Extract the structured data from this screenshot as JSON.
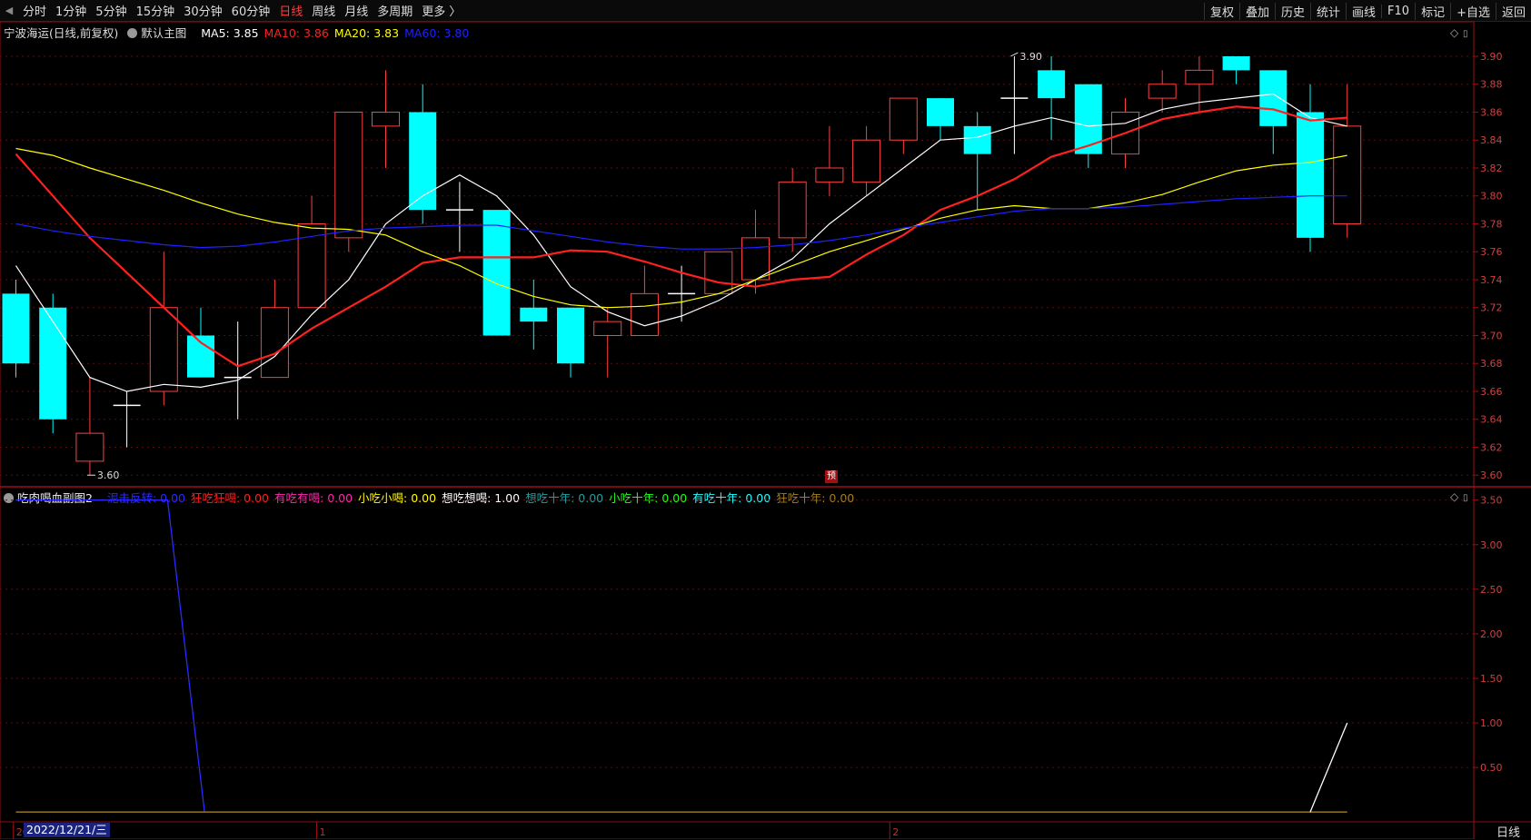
{
  "toolbar": {
    "periods": [
      "分时",
      "1分钟",
      "5分钟",
      "15分钟",
      "30分钟",
      "60分钟",
      "日线",
      "周线",
      "月线",
      "多周期",
      "更多 〉"
    ],
    "active_period": "日线",
    "right_buttons": [
      "复权",
      "叠加",
      "历史",
      "统计",
      "画线",
      "F10",
      "标记",
      "+自选",
      "返回"
    ]
  },
  "main_panel": {
    "stock_name": "宁波海运",
    "mode": "(日线,前复权)",
    "template": "默认主图",
    "ma": [
      {
        "label": "MA5: 3.85",
        "color": "#ffffff"
      },
      {
        "label": "MA10: 3.86",
        "color": "#ff2020"
      },
      {
        "label": "MA20: 3.83",
        "color": "#ffff00"
      },
      {
        "label": "MA60: 3.80",
        "color": "#2020ff"
      }
    ],
    "high_marker": "3.90",
    "low_marker": "3.60",
    "pre_tag": "预"
  },
  "sub_panel": {
    "title": "吃肉喝血副图2",
    "items": [
      {
        "label": "泥击反转: 0.00",
        "color": "#2a2aff"
      },
      {
        "label": "狂吃狂喝: 0.00",
        "color": "#ff2020"
      },
      {
        "label": "有吃有喝: 0.00",
        "color": "#ff2ab0"
      },
      {
        "label": "小吃小喝: 0.00",
        "color": "#ffff00"
      },
      {
        "label": "想吃想喝: 1.00",
        "color": "#ffffff"
      },
      {
        "label": "想吃十年: 0.00",
        "color": "#20a0a0"
      },
      {
        "label": "小吃十年: 0.00",
        "color": "#20ff20"
      },
      {
        "label": "有吃十年: 0.00",
        "color": "#20ffff"
      },
      {
        "label": "狂吃十年: 0.00",
        "color": "#a08020"
      }
    ]
  },
  "bottom": {
    "date_label": "2022/12/21/三",
    "month_marks": [
      "20",
      "1",
      "2"
    ],
    "period_label": "日线"
  },
  "chart_data": {
    "type": "candlestick",
    "y_axis_main": [
      "3.90",
      "3.88",
      "3.86",
      "3.84",
      "3.82",
      "3.80",
      "3.78",
      "3.76",
      "3.74",
      "3.72",
      "3.70",
      "3.68",
      "3.66",
      "3.64",
      "3.62",
      "3.60"
    ],
    "ylim_main": [
      3.593,
      3.913
    ],
    "y_axis_sub": [
      "3.50",
      "3.00",
      "2.50",
      "2.00",
      "1.50",
      "1.00",
      "0.50"
    ],
    "ylim_sub": [
      -0.1,
      3.65
    ],
    "up_color": "#ff4040",
    "down_color": "#00ffff",
    "candles": [
      {
        "o": 3.73,
        "h": 3.74,
        "l": 3.67,
        "c": 3.68
      },
      {
        "o": 3.72,
        "h": 3.73,
        "l": 3.63,
        "c": 3.64
      },
      {
        "o": 3.61,
        "h": 3.67,
        "l": 3.6,
        "c": 3.63
      },
      {
        "o": 3.65,
        "h": 3.66,
        "l": 3.62,
        "c": 3.65
      },
      {
        "o": 3.66,
        "h": 3.76,
        "l": 3.65,
        "c": 3.72
      },
      {
        "o": 3.7,
        "h": 3.72,
        "l": 3.67,
        "c": 3.67
      },
      {
        "o": 3.67,
        "h": 3.71,
        "l": 3.64,
        "c": 3.67
      },
      {
        "o": 3.67,
        "h": 3.74,
        "l": 3.67,
        "c": 3.72
      },
      {
        "o": 3.72,
        "h": 3.8,
        "l": 3.72,
        "c": 3.78
      },
      {
        "o": 3.77,
        "h": 3.86,
        "l": 3.76,
        "c": 3.86
      },
      {
        "o": 3.85,
        "h": 3.89,
        "l": 3.82,
        "c": 3.86
      },
      {
        "o": 3.86,
        "h": 3.88,
        "l": 3.78,
        "c": 3.79
      },
      {
        "o": 3.79,
        "h": 3.81,
        "l": 3.76,
        "c": 3.79
      },
      {
        "o": 3.79,
        "h": 3.79,
        "l": 3.7,
        "c": 3.7
      },
      {
        "o": 3.72,
        "h": 3.74,
        "l": 3.69,
        "c": 3.71
      },
      {
        "o": 3.72,
        "h": 3.72,
        "l": 3.67,
        "c": 3.68
      },
      {
        "o": 3.7,
        "h": 3.72,
        "l": 3.67,
        "c": 3.71
      },
      {
        "o": 3.7,
        "h": 3.75,
        "l": 3.7,
        "c": 3.73
      },
      {
        "o": 3.73,
        "h": 3.75,
        "l": 3.71,
        "c": 3.73
      },
      {
        "o": 3.73,
        "h": 3.76,
        "l": 3.73,
        "c": 3.76
      },
      {
        "o": 3.74,
        "h": 3.79,
        "l": 3.73,
        "c": 3.77
      },
      {
        "o": 3.77,
        "h": 3.82,
        "l": 3.76,
        "c": 3.81
      },
      {
        "o": 3.81,
        "h": 3.85,
        "l": 3.8,
        "c": 3.82
      },
      {
        "o": 3.81,
        "h": 3.85,
        "l": 3.8,
        "c": 3.84
      },
      {
        "o": 3.84,
        "h": 3.87,
        "l": 3.83,
        "c": 3.87
      },
      {
        "o": 3.87,
        "h": 3.87,
        "l": 3.84,
        "c": 3.85
      },
      {
        "o": 3.85,
        "h": 3.86,
        "l": 3.79,
        "c": 3.83
      },
      {
        "o": 3.87,
        "h": 3.9,
        "l": 3.83,
        "c": 3.87
      },
      {
        "o": 3.89,
        "h": 3.9,
        "l": 3.84,
        "c": 3.87
      },
      {
        "o": 3.88,
        "h": 3.88,
        "l": 3.82,
        "c": 3.83
      },
      {
        "o": 3.83,
        "h": 3.87,
        "l": 3.82,
        "c": 3.86
      },
      {
        "o": 3.87,
        "h": 3.89,
        "l": 3.86,
        "c": 3.88
      },
      {
        "o": 3.88,
        "h": 3.9,
        "l": 3.86,
        "c": 3.89
      },
      {
        "o": 3.9,
        "h": 3.9,
        "l": 3.88,
        "c": 3.89
      },
      {
        "o": 3.89,
        "h": 3.89,
        "l": 3.83,
        "c": 3.85
      },
      {
        "o": 3.86,
        "h": 3.88,
        "l": 3.76,
        "c": 3.77
      },
      {
        "o": 3.78,
        "h": 3.88,
        "l": 3.77,
        "c": 3.85
      }
    ],
    "series": [
      {
        "name": "MA5",
        "color": "#ffffff",
        "values": [
          3.75,
          3.71,
          3.67,
          3.66,
          3.665,
          3.663,
          3.668,
          3.685,
          3.715,
          3.74,
          3.78,
          3.8,
          3.815,
          3.8,
          3.772,
          3.735,
          3.717,
          3.707,
          3.714,
          3.725,
          3.74,
          3.755,
          3.78,
          3.8,
          3.82,
          3.84,
          3.842,
          3.85,
          3.856,
          3.85,
          3.852,
          3.862,
          3.867,
          3.87,
          3.873,
          3.856,
          3.85
        ]
      },
      {
        "name": "MA10",
        "color": "#ff2020",
        "values": [
          3.83,
          3.8,
          3.77,
          3.745,
          3.72,
          3.695,
          3.678,
          3.687,
          3.705,
          3.72,
          3.735,
          3.752,
          3.756,
          3.756,
          3.756,
          3.761,
          3.76,
          3.753,
          3.745,
          3.738,
          3.735,
          3.74,
          3.742,
          3.758,
          3.772,
          3.79,
          3.8,
          3.812,
          3.828,
          3.836,
          3.845,
          3.855,
          3.86,
          3.864,
          3.862,
          3.854,
          3.856
        ]
      },
      {
        "name": "MA20",
        "color": "#ffff00",
        "values": [
          3.834,
          3.829,
          3.82,
          3.812,
          3.804,
          3.795,
          3.787,
          3.781,
          3.777,
          3.776,
          3.772,
          3.76,
          3.75,
          3.737,
          3.728,
          3.722,
          3.72,
          3.721,
          3.724,
          3.73,
          3.74,
          3.75,
          3.76,
          3.768,
          3.776,
          3.784,
          3.79,
          3.793,
          3.791,
          3.791,
          3.795,
          3.801,
          3.81,
          3.818,
          3.822,
          3.824,
          3.829
        ]
      },
      {
        "name": "MA60",
        "color": "#2020ff",
        "values": [
          3.78,
          3.775,
          3.771,
          3.768,
          3.765,
          3.763,
          3.764,
          3.767,
          3.771,
          3.775,
          3.777,
          3.778,
          3.779,
          3.779,
          3.775,
          3.771,
          3.767,
          3.764,
          3.762,
          3.762,
          3.763,
          3.765,
          3.768,
          3.772,
          3.777,
          3.781,
          3.785,
          3.789,
          3.791,
          3.791,
          3.792,
          3.794,
          3.796,
          3.798,
          3.799,
          3.8,
          3.8
        ]
      }
    ],
    "sub_series": [
      {
        "name": "泥击反转",
        "color": "#2a2aff",
        "points": [
          [
            0,
            3.5
          ],
          [
            4.1,
            3.5
          ],
          [
            5.1,
            0
          ]
        ]
      },
      {
        "name": "基线",
        "color": "#a08020",
        "points": [
          [
            0,
            0
          ],
          [
            36,
            0
          ]
        ]
      },
      {
        "name": "想吃想喝",
        "color": "#ffffff",
        "points": [
          [
            35,
            0
          ],
          [
            36,
            1.0
          ]
        ]
      }
    ],
    "grid": true
  }
}
